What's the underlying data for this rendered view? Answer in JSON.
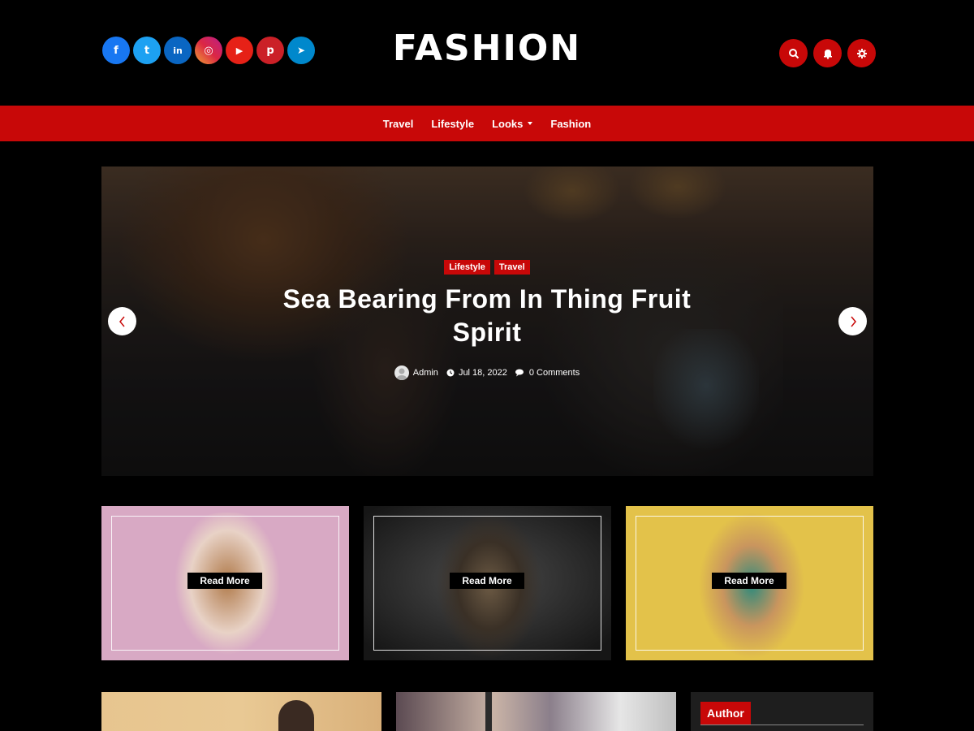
{
  "header": {
    "logo_text": "FASHION",
    "social": [
      {
        "name": "facebook",
        "glyph": "f",
        "color": "#1877f2"
      },
      {
        "name": "twitter",
        "glyph": "t",
        "color": "#1da1f2"
      },
      {
        "name": "linkedin",
        "glyph": "in",
        "color": "#0a66c2"
      },
      {
        "name": "instagram",
        "glyph": "◎",
        "color": "#d6249f"
      },
      {
        "name": "youtube",
        "glyph": "▶",
        "color": "#e62117"
      },
      {
        "name": "pinterest",
        "glyph": "p",
        "color": "#cb2027"
      },
      {
        "name": "telegram",
        "glyph": "➤",
        "color": "#0088cc"
      }
    ],
    "actions": [
      "search-icon",
      "bell-icon",
      "settings-icon"
    ],
    "accent": "#c80808"
  },
  "nav": {
    "items": [
      {
        "label": "Travel"
      },
      {
        "label": "Lifestyle"
      },
      {
        "label": "Looks"
      },
      {
        "label": "Fashion"
      }
    ]
  },
  "hero": {
    "categories": [
      "Lifestyle",
      "Travel"
    ],
    "title": "Sea Bearing From In Thing Fruit Spirit",
    "author": "Admin",
    "date": "Jul 18, 2022",
    "comments": "0 Comments"
  },
  "cards": [
    {
      "label": "Read More",
      "bg": "#d8a9c4"
    },
    {
      "label": "Read More",
      "bg": "#2a2a2a"
    },
    {
      "label": "Read More",
      "bg": "#e3c24a"
    }
  ],
  "sidebar": {
    "author_title": "Author"
  }
}
